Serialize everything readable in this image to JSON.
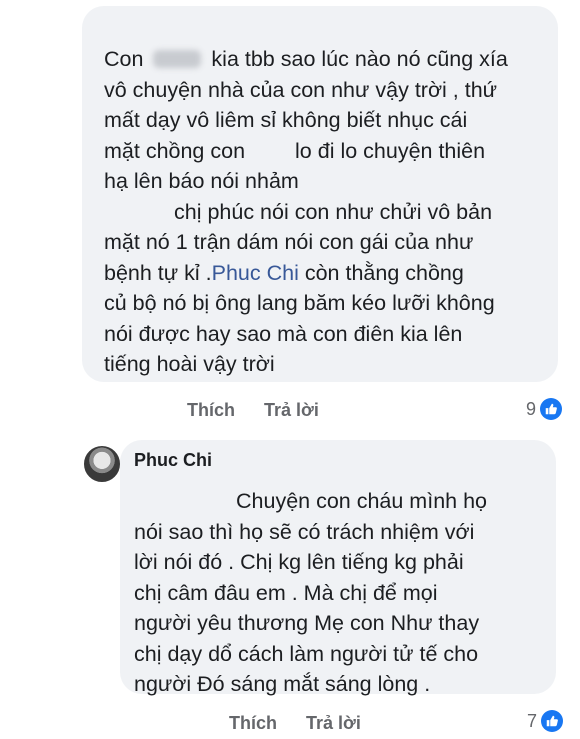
{
  "comment1": {
    "lines": [
      {
        "pre": "Con",
        "post": "kia tbb  sao lúc nào nó cũng xía"
      },
      "vô chuyện nhà của con như vậy trời , thứ",
      "mất dạy vô liêm sỉ không biết nhục cái",
      {
        "pre": "mặt chồng con",
        "post": "lo đi lo chuyện thiên"
      },
      "hạ lên báo nói nhảm",
      "chị phúc nói con như chửi vô bản",
      "mặt nó 1 trận dám nói con gái của như",
      {
        "pre": "bệnh tự kỉ .",
        "mention": "Phuc Chi",
        "post": "  còn thằng  chồng"
      },
      "củ bộ nó bị ông  lang băm kéo lưỡi không",
      "nói được hay sao mà con điên kia lên",
      "tiếng hoài vậy trời"
    ],
    "like_label": "Thích",
    "reply_label": "Trả lời",
    "reaction_count": "9"
  },
  "comment2": {
    "author": "Phuc Chi",
    "lines": [
      "Chuyện con cháu mình họ",
      "nói sao thì họ sẽ có trách nhiệm với",
      "lời nói đó . Chị kg lên tiếng kg phải",
      "chị câm đâu em . Mà chị để mọi",
      "người yêu thương Mẹ con Như thay",
      "chị dạy dổ cách làm người tử tế cho",
      "người Đó sáng mắt sáng lòng ."
    ],
    "like_label": "Thích",
    "reply_label": "Trả lời",
    "reaction_count": "7"
  },
  "colors": {
    "bubble": "#f0f2f5",
    "mention": "#385898",
    "like_icon": "#1877f2",
    "muted": "#65676b"
  },
  "icons": {
    "reaction": "like-thumb-icon",
    "avatar": "avatar"
  }
}
